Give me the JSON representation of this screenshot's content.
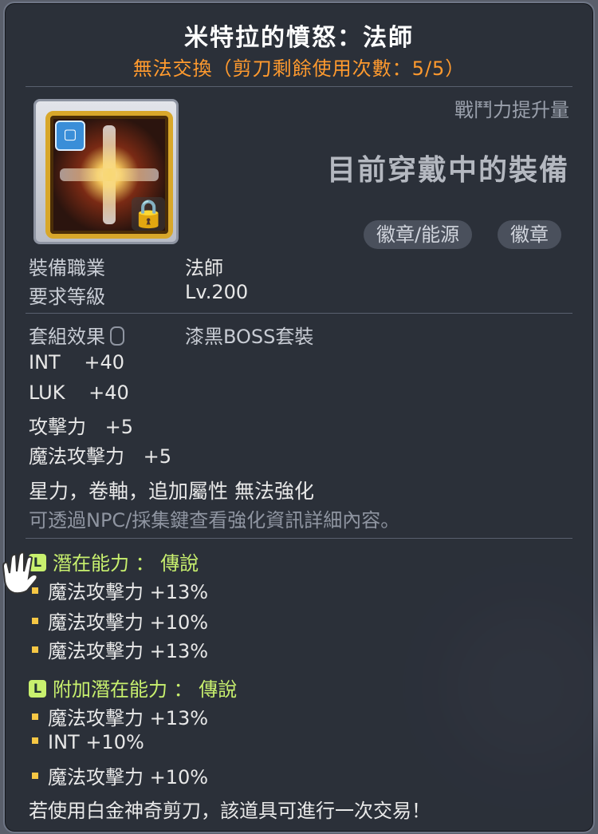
{
  "item": {
    "name": "米特拉的憤怒：法師",
    "trade_note": "無法交換（剪刀剩餘使用次數：5/5）",
    "icon": "mitra-rage-emblem-icon"
  },
  "compare": {
    "power_label": "戰鬥力提升量",
    "equipped_label": "目前穿戴中的裝備"
  },
  "tags": [
    "徽章/能源",
    "徽章"
  ],
  "requirements": {
    "job_label": "裝備職業",
    "job_value": "法師",
    "level_label": "要求等級",
    "level_value": "Lv.200"
  },
  "set": {
    "label": "套組效果",
    "value": "漆黑BOSS套裝"
  },
  "stats": [
    {
      "name": "INT",
      "value": "+40"
    },
    {
      "name": "LUK",
      "value": "+40"
    },
    {
      "name": "攻擊力",
      "value": "+5"
    },
    {
      "name": "魔法攻擊力",
      "value": "+5"
    }
  ],
  "enhance_note": "星力，卷軸，追加屬性 無法強化",
  "npc_note": "可透過NPC/採集鍵查看強化資訊詳細內容。",
  "potential": {
    "title": "潛在能力 ： 傳說",
    "lines": [
      "魔法攻擊力 +13%",
      "魔法攻擊力 +10%",
      "魔法攻擊力 +13%"
    ]
  },
  "bonus_potential": {
    "title": "附加潛在能力 ： 傳說",
    "lines": [
      "魔法攻擊力 +13%",
      "INT +10%",
      "魔法攻擊力 +10%"
    ]
  },
  "footer": "若使用白金神奇剪刀，該道具可進行一次交易！",
  "colors": {
    "title": "#ffffff",
    "trade_note": "#ff9a2e",
    "potential": "#c8f06e",
    "bullet": "#f6c744"
  }
}
